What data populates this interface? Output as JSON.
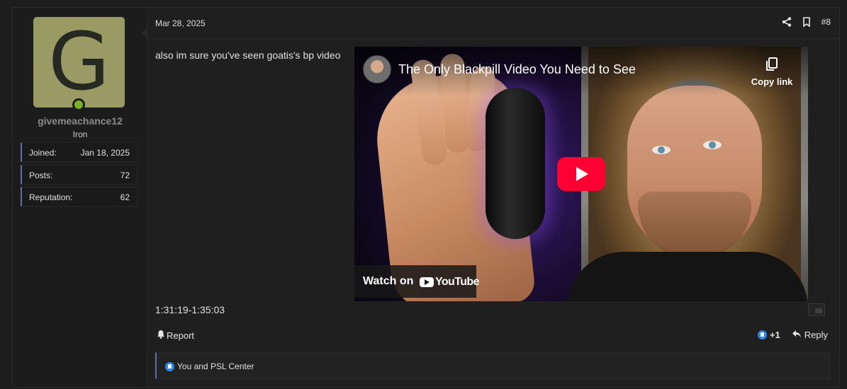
{
  "user": {
    "avatar_letter": "G",
    "online": true,
    "username": "givemeachance12",
    "title": "Iron",
    "stats": [
      {
        "label": "Joined:",
        "value": "Jan 18, 2025"
      },
      {
        "label": "Posts:",
        "value": "72"
      },
      {
        "label": "Reputation:",
        "value": "62"
      }
    ]
  },
  "post": {
    "date": "Mar 28, 2025",
    "number": "#8",
    "text": "also im sure you've seen goatis's bp video",
    "timecode": "1:31:19-1:35:03"
  },
  "video": {
    "title": "The Only Blackpill Video You Need to See",
    "copy_label": "Copy link",
    "watch_label": "Watch on",
    "brand": "YouTube"
  },
  "actions": {
    "report_label": "Report",
    "reaction_count": "+1",
    "reply_label": "Reply"
  },
  "reactions": {
    "text": "You and PSL Center"
  },
  "colors": {
    "accent_bar": "#5a6fb0",
    "online": "#7bb121",
    "like": "#2f86e6",
    "play": "#ff0033"
  }
}
